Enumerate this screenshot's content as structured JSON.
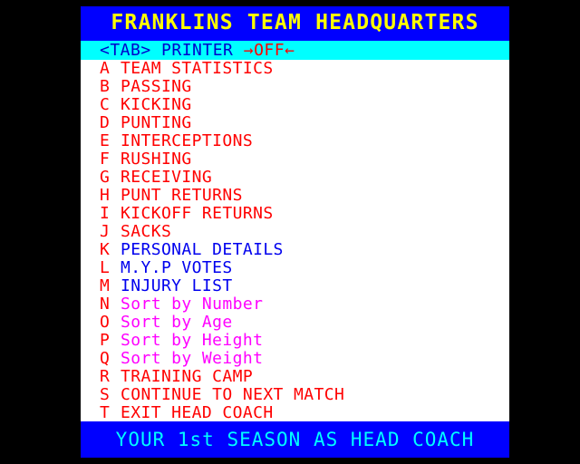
{
  "screen": {
    "background_color": "#000000",
    "panel_background": "#ffffff"
  },
  "header": {
    "title": "FRANKLINS TEAM HEADQUARTERS",
    "background_color": "#0000ff",
    "text_color": "#ffff00"
  },
  "printer_row": {
    "key_label": "<TAB>",
    "name": "PRINTER",
    "arrow_left": "→",
    "arrow_right": "←",
    "value": "OFF",
    "background_color": "#00ffff",
    "label_color": "#0000cc",
    "value_color": "#ff0000"
  },
  "menu": {
    "items": [
      {
        "key": "A",
        "label": "TEAM STATISTICS",
        "color_class": "c-red"
      },
      {
        "key": "B",
        "label": "PASSING",
        "color_class": "c-red"
      },
      {
        "key": "C",
        "label": "KICKING",
        "color_class": "c-red"
      },
      {
        "key": "D",
        "label": "PUNTING",
        "color_class": "c-red"
      },
      {
        "key": "E",
        "label": "INTERCEPTIONS",
        "color_class": "c-red"
      },
      {
        "key": "F",
        "label": "RUSHING",
        "color_class": "c-red"
      },
      {
        "key": "G",
        "label": "RECEIVING",
        "color_class": "c-red"
      },
      {
        "key": "H",
        "label": "PUNT RETURNS",
        "color_class": "c-red"
      },
      {
        "key": "I",
        "label": "KICKOFF RETURNS",
        "color_class": "c-red"
      },
      {
        "key": "J",
        "label": "SACKS",
        "color_class": "c-red"
      },
      {
        "key": "K",
        "label": "PERSONAL DETAILS",
        "color_class": "c-blue"
      },
      {
        "key": "L",
        "label": "M.Y.P VOTES",
        "color_class": "c-blue"
      },
      {
        "key": "M",
        "label": "INJURY LIST",
        "color_class": "c-blue"
      },
      {
        "key": "N",
        "label": "Sort by Number",
        "color_class": "c-magenta"
      },
      {
        "key": "O",
        "label": "Sort by Age",
        "color_class": "c-magenta"
      },
      {
        "key": "P",
        "label": "Sort by Height",
        "color_class": "c-magenta"
      },
      {
        "key": "Q",
        "label": "Sort by Weight",
        "color_class": "c-magenta"
      },
      {
        "key": "R",
        "label": "TRAINING CAMP",
        "color_class": "c-red"
      },
      {
        "key": "S",
        "label": "CONTINUE TO NEXT MATCH",
        "color_class": "c-red"
      },
      {
        "key": "T",
        "label": "EXIT HEAD COACH",
        "color_class": "c-red"
      }
    ],
    "key_color": "#ff0000"
  },
  "status": {
    "text": "YOUR 1st SEASON AS HEAD COACH",
    "background_color": "#0000ff",
    "text_color": "#00ffff"
  }
}
